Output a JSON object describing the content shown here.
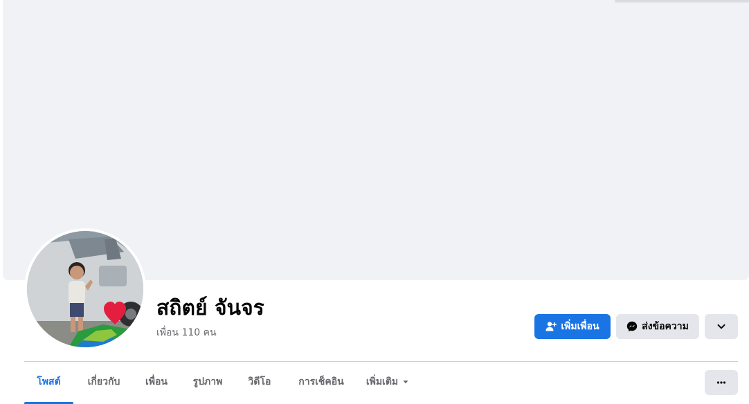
{
  "profile": {
    "name": "สถิตย์ จันจร",
    "friends_count": "เพื่อน 110 คน"
  },
  "actions": {
    "add_friend_label": "เพิ่มเพื่อน",
    "message_label": "ส่งข้อความ"
  },
  "tabs": [
    {
      "label": "โพสต์",
      "active": true
    },
    {
      "label": "เกี่ยวกับ",
      "active": false
    },
    {
      "label": "เพื่อน",
      "active": false
    },
    {
      "label": "รูปภาพ",
      "active": false
    },
    {
      "label": "วิดีโอ",
      "active": false
    },
    {
      "label": "การเช็คอิน",
      "active": false
    },
    {
      "label": "เพิ่มเติม",
      "active": false
    }
  ],
  "icons": {
    "add_friend": "add-person-icon",
    "message": "messenger-icon",
    "more_chevron": "chevron-down-icon",
    "tab_more_caret": "caret-down-icon",
    "overflow": "more-dots-icon",
    "avatar_badge": "heart-frame-icon"
  },
  "colors": {
    "accent": "#1b74e4",
    "secondary_button": "#e4e6eb",
    "cover_placeholder": "#f0f2f5",
    "muted_text": "#65676b"
  }
}
